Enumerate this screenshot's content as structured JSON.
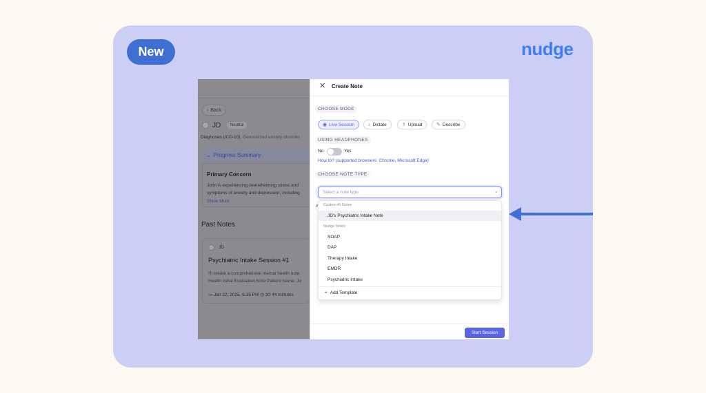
{
  "badge": {
    "label": "New"
  },
  "brand": {
    "logo_text": "nudge",
    "accent": "#3f7ef5"
  },
  "background_app": {
    "back_label": "Back",
    "client": {
      "initials": "JD",
      "mood": "Neutral"
    },
    "diagnoses_label": "Diagnoses (ICD-10):",
    "diagnoses_value": "Generalized anxiety disorder",
    "progress_summary_label": "Progress Summary",
    "primary_concern_label": "Primary Concern",
    "primary_concern_text_1": "John is experiencing overwhelming stress and",
    "primary_concern_text_2": "symptoms of anxiety and depression, including",
    "show_more_label": "Show More",
    "past_notes_label": "Past Notes",
    "session": {
      "initials": "JD",
      "title": "Psychiatric Intake Session #1",
      "preview_1": "I'll create a comprehensive mental health note",
      "preview_2": "Health Initial Evaluation Note Patient Name: Jo",
      "date": "Jan 22, 2025, 6:35 PM",
      "duration": "30-44 minutes"
    }
  },
  "modal": {
    "title": "Create Note",
    "choose_mode_label": "CHOOSE MODE",
    "modes": [
      {
        "label": "Live Session",
        "icon": "waveform-icon",
        "active": true
      },
      {
        "label": "Dictate",
        "icon": "mic-icon",
        "active": false
      },
      {
        "label": "Upload",
        "icon": "upload-icon",
        "active": false
      },
      {
        "label": "Describe",
        "icon": "pencil-icon",
        "active": false
      }
    ],
    "headphones_label": "USING HEADPHONES",
    "toggle_no": "No",
    "toggle_yes": "Yes",
    "howto_link": "How to? (supported browsers: Chrome, Microsoft Edge)",
    "note_type_label": "CHOOSE NOTE TYPE",
    "note_type_placeholder": "Select a note type",
    "dropdown": {
      "custom_group": "Custom AI Notes",
      "custom_items": [
        "JD's Psychiatric Intake Note"
      ],
      "nudge_group": "Nudge Notes",
      "nudge_items": [
        "SOAP",
        "DAP",
        "Therapy Intake",
        "EMDR",
        "Psychiatric Intake"
      ],
      "add_template_label": "Add Template"
    },
    "start_button_label": "Start Session",
    "primary_color": "#5965e0"
  },
  "pointer_arrow_color": "#3f6fd0"
}
